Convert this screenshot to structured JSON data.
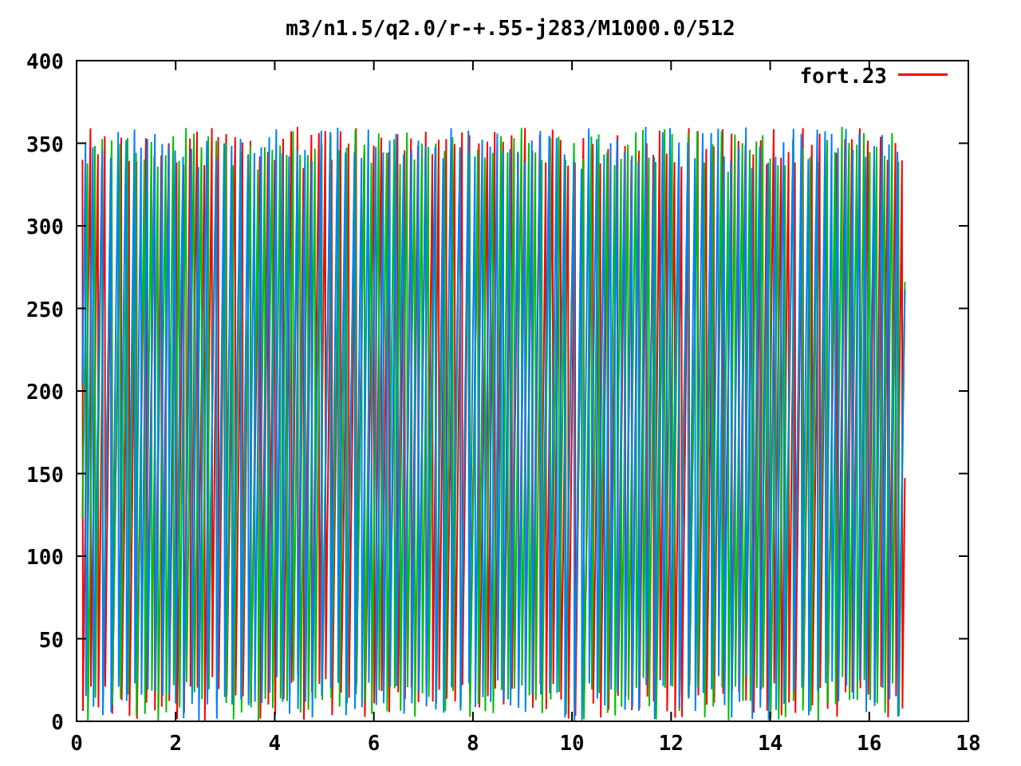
{
  "title": "m3/n1.5/q2.0/r-+.55-j283/M1000.0/512",
  "y_axis": {
    "ticks": [
      "400",
      "350",
      "300",
      "250",
      "200",
      "150",
      "100",
      "50",
      "0"
    ]
  },
  "x_axis": {
    "ticks": [
      "0",
      "2",
      "4",
      "6",
      "8",
      "10",
      "12",
      "14",
      "16",
      "18"
    ]
  },
  "legend": [
    {
      "label": "fort.23",
      "color": "#ff0000"
    }
  ]
}
